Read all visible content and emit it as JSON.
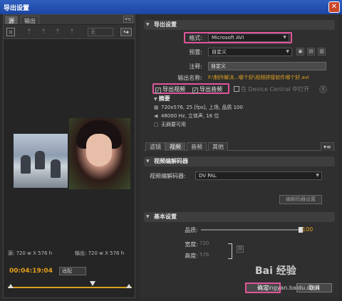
{
  "window": {
    "title": "导出设置",
    "close_label": "✕"
  },
  "left": {
    "tabs": [
      "源",
      "输出"
    ],
    "menu_icon": "panel-menu-icon",
    "zoom_label": "无",
    "source_dims": "源: 720 w X 576 h",
    "output_dims": "输出: 720 w X 576 h",
    "timecode": "00:04:19:04",
    "fit_label": "适配"
  },
  "export": {
    "section_title": "导出设置",
    "format_label": "格式:",
    "format_value": "Microsoft AVI",
    "preset_label": "预置:",
    "preset_value": "自定义",
    "comment_label": "注释:",
    "comment_value": "自定义",
    "output_label": "输出名称:",
    "output_path": "F:\\制作解决...哪个好\\视频拼接软件哪个好.avi",
    "export_video": "导出视频",
    "export_audio": "导出音频",
    "device_central": "在 Device Central 中打开",
    "summary_title": "摘要",
    "summary_video": "720x576, 25 [fps], 上场, 品质 100",
    "summary_audio": "48000 Hz, 立体声, 16 位",
    "summary_none": "无摘要可用"
  },
  "tabs": [
    "滤镜",
    "视频",
    "音频",
    "其他"
  ],
  "codec": {
    "section_title": "视频编解码器",
    "label": "视频编解码器:",
    "value": "DV PAL",
    "setup_button": "编解码器设置"
  },
  "basic": {
    "section_title": "基本设置",
    "quality_label": "品质:",
    "quality_value": "100",
    "width_label": "宽度:",
    "width_value": "720",
    "height_label": "高度:",
    "height_value": "576"
  },
  "buttons": {
    "ok": "确定",
    "cancel": "取消"
  },
  "watermark": {
    "logo": "Bai 经验",
    "site": "jingyan.baidu.com"
  },
  "colors": {
    "accent_orange": "#e0a020",
    "highlight_pink": "#e0559b",
    "title_blue": "#2e5fbf"
  }
}
